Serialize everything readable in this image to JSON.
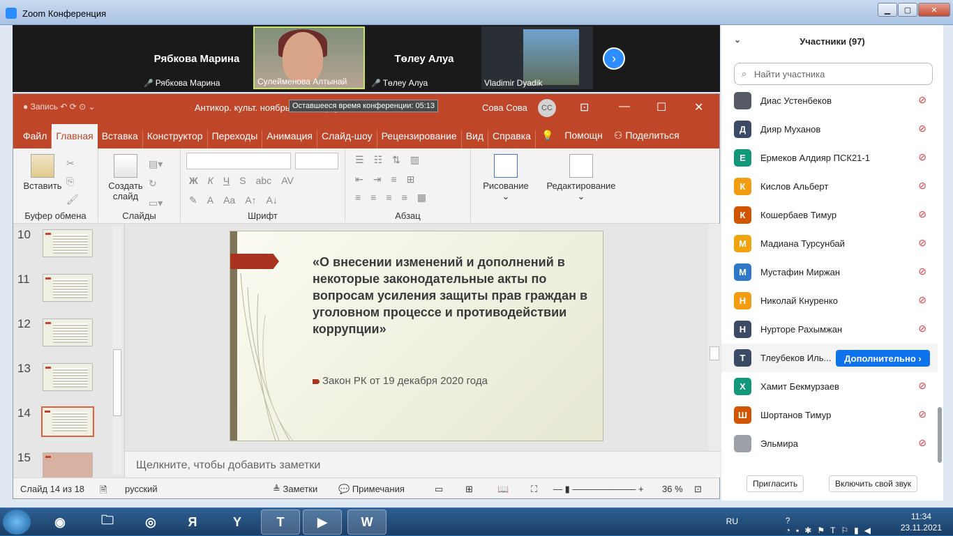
{
  "zoom": {
    "window_title": "Zoom Конференция",
    "video_tiles": [
      {
        "big_name": "Рябкова Марина",
        "small_name": "Рябкова Марина"
      },
      {
        "small_name": "Сулейменова Алтынай"
      },
      {
        "big_name": "Төлеу Алуа",
        "small_name": "Төлеу Алуа"
      },
      {
        "small_name": "Vladimir Dyadik"
      }
    ],
    "next_arrow": "›"
  },
  "ppt": {
    "quick_access": "Запись",
    "doc_title": "Антикор. культ. ноябрь 2021 Карту - PowerPoint",
    "timer_tooltip": "Оставшееся время конференции: 05:13",
    "user_name": "Сова Сова",
    "user_initials": "СС",
    "tabs": [
      "Файл",
      "Главная",
      "Вставка",
      "Конструктор",
      "Переходы",
      "Анимация",
      "Слайд-шоу",
      "Рецензирование",
      "Вид",
      "Справка"
    ],
    "help": "Помощн",
    "share": "Поделиться",
    "ribbon": {
      "paste": "Вставить",
      "clipboard": "Буфер обмена",
      "new_slide_1": "Создать",
      "new_slide_2": "слайд",
      "slides": "Слайды",
      "font": "Шрифт",
      "paragraph": "Абзац",
      "drawing": "Рисование",
      "editing": "Редактирование"
    },
    "thumbnails": [
      "10",
      "11",
      "12",
      "13",
      "14",
      "15"
    ],
    "selected_slide": "14",
    "slide": {
      "heading": "«О внесении изменений и дополнений в некоторые законодательные акты по вопросам усиления защиты прав граждан в уголовном процессе и противодействии коррупции»",
      "sub": "Закон РК от 19 декабря 2020 года"
    },
    "notes_placeholder": "Щелкните, чтобы добавить заметки",
    "status": {
      "slide_info": "Слайд 14 из 18",
      "language": "русский",
      "notes": "Заметки",
      "comments": "Примечания",
      "zoom": "36 %"
    }
  },
  "participants": {
    "title": "Участники (97)",
    "search_placeholder": "Найти участника",
    "list": [
      {
        "initial": "",
        "name": "Диас Устенбеков",
        "color": "#555a66"
      },
      {
        "initial": "Д",
        "name": "Дияр Муханов",
        "color": "#3b4b66"
      },
      {
        "initial": "Е",
        "name": "Ермеков Алдияр ПСК21-1",
        "color": "#13977a"
      },
      {
        "initial": "К",
        "name": "Кислов Альберт",
        "color": "#f39c12"
      },
      {
        "initial": "К",
        "name": "Кошербаев Тимур",
        "color": "#d35400"
      },
      {
        "initial": "М",
        "name": "Мадиана Турсунбай",
        "color": "#f0a30a"
      },
      {
        "initial": "М",
        "name": "Мустафин Миржан",
        "color": "#2e78c7"
      },
      {
        "initial": "Н",
        "name": "Николай Кнуренко",
        "color": "#f39c12"
      },
      {
        "initial": "Н",
        "name": "Нурторе Рахымжан",
        "color": "#3b4b66"
      },
      {
        "initial": "Т",
        "name": "Тлеубеков Иль...",
        "color": "#3b4b66"
      },
      {
        "initial": "Х",
        "name": "Хамит Бекмурзаев",
        "color": "#13977a"
      },
      {
        "initial": "Ш",
        "name": "Шортанов Тимур",
        "color": "#d35400"
      },
      {
        "initial": "",
        "name": "Эльмира",
        "color": "#9aa0a6"
      }
    ],
    "more_button": "Дополнительно",
    "invite": "Пригласить",
    "unmute": "Включить свой звук"
  },
  "taskbar": {
    "lang": "RU",
    "time": "11:34",
    "date": "23.11.2021"
  }
}
